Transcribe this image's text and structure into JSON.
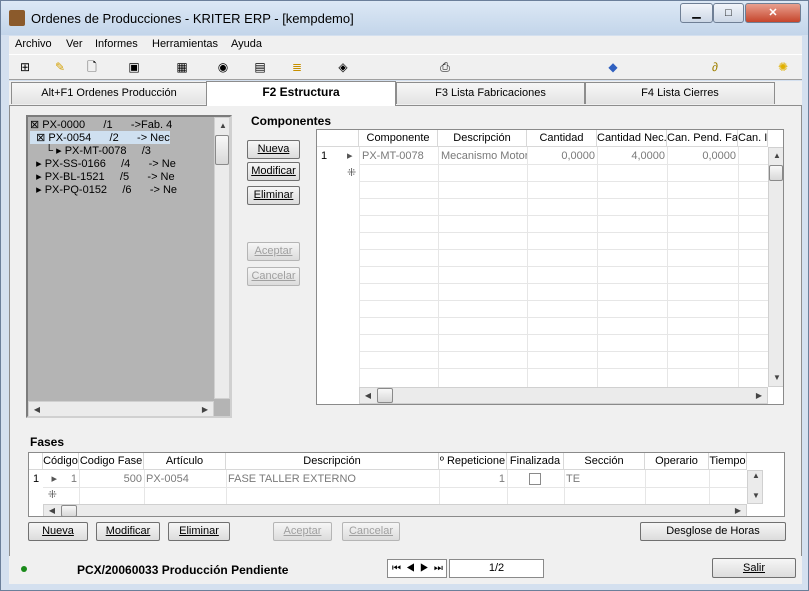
{
  "window": {
    "title": "Ordenes de Producciones - KRITER ERP - [kempdemo]",
    "min": "▁",
    "max": "□",
    "close": "✕"
  },
  "menu": [
    "Archivo",
    "Ver",
    "Informes",
    "Herramientas",
    "Ayuda"
  ],
  "toolbar": [
    "tree-icon",
    "pencil-icon",
    "print-preview-icon",
    "find-icon",
    "calc-icon",
    "globe-icon",
    "clipboard-icon",
    "checklist-icon",
    "stats-icon",
    "printer-icon",
    "tag-icon",
    "paperclip-icon",
    "lightbulb-icon"
  ],
  "tabs": [
    "Alt+F1 Ordenes Producción",
    "F2 Estructura",
    "F3 Lista Fabricaciones",
    "F4 Lista Cierres"
  ],
  "tree": [
    {
      "text": "⊠ PX-0000      /1      ->Fab. 4"
    },
    {
      "text": "  ⊠ PX-0054      /2      -> Nec"
    },
    {
      "text": "     └ ▸ PX-MT-0078     /3"
    },
    {
      "text": "  ▸ PX-SS-0166     /4      -> Ne"
    },
    {
      "text": "  ▸ PX-BL-1521     /5      -> Ne"
    },
    {
      "text": "  ▸ PX-PQ-0152     /6      -> Ne"
    }
  ],
  "componentes": {
    "title": "Componentes",
    "buttons": {
      "nueva": "Nueva",
      "modificar": "Modificar",
      "eliminar": "Eliminar",
      "aceptar": "Aceptar",
      "cancelar": "Cancelar"
    },
    "columns": [
      "Componente",
      "Descripción",
      "Cantidad",
      "Cantidad Nec.",
      "Can. Pend. Fab",
      "Can. I"
    ],
    "rows": [
      {
        "num": "1",
        "componente": "PX-MT-0078",
        "descripcion": "Mecanismo Motor",
        "cantidad": "0,0000",
        "nec": "4,0000",
        "pend": "0,0000"
      }
    ]
  },
  "fases": {
    "title": "Fases",
    "columns": [
      "Código",
      "Codigo Fase",
      "Artículo",
      "Descripción",
      "º Repeticione",
      "Finalizada",
      "Sección",
      "Operario",
      "Tiempo"
    ],
    "rows": [
      {
        "num": "1",
        "codigo": "1",
        "fase": "500",
        "articulo": "PX-0054",
        "descripcion": "FASE TALLER EXTERNO",
        "rep": "1",
        "seccion": "TE"
      }
    ],
    "buttons": {
      "nueva": "Nueva",
      "modificar": "Modificar",
      "eliminar": "Eliminar",
      "aceptar": "Aceptar",
      "cancelar": "Cancelar",
      "desglose": "Desglose de Horas"
    }
  },
  "status": {
    "text": "PCX/20060033 Producción Pendiente",
    "page": "1/2",
    "salir": "Salir"
  }
}
